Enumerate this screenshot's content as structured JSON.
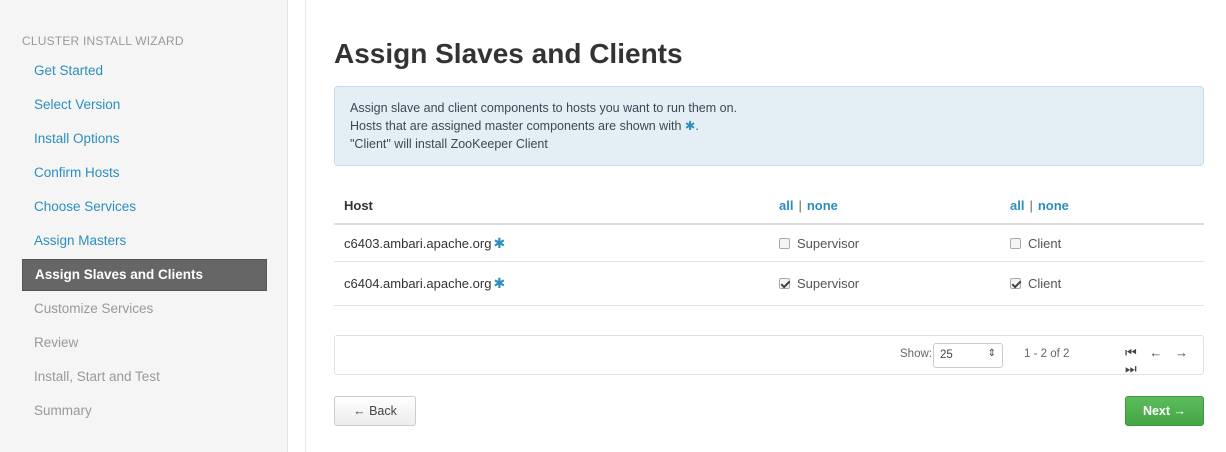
{
  "sidebar": {
    "header": "CLUSTER INSTALL WIZARD",
    "items": [
      {
        "label": "Get Started",
        "state": "link"
      },
      {
        "label": "Select Version",
        "state": "link"
      },
      {
        "label": "Install Options",
        "state": "link"
      },
      {
        "label": "Confirm Hosts",
        "state": "link"
      },
      {
        "label": "Choose Services",
        "state": "link"
      },
      {
        "label": "Assign Masters",
        "state": "link"
      },
      {
        "label": "Assign Slaves and Clients",
        "state": "active"
      },
      {
        "label": "Customize Services",
        "state": "disabled"
      },
      {
        "label": "Review",
        "state": "disabled"
      },
      {
        "label": "Install, Start and Test",
        "state": "disabled"
      },
      {
        "label": "Summary",
        "state": "disabled"
      }
    ]
  },
  "main": {
    "title": "Assign Slaves and Clients",
    "alert": {
      "line1": "Assign slave and client components to hosts you want to run them on.",
      "line2": "Hosts that are assigned master components are shown with",
      "line2_marker": "✱",
      "line2_end": ".",
      "line3": "\"Client\" will install ZooKeeper Client"
    },
    "table": {
      "host_header": "Host",
      "all_label": "all",
      "separator": "|",
      "none_label": "none",
      "host_marker": "✱",
      "rows": [
        {
          "host": "c6403.ambari.apache.org",
          "supervisor": "Supervisor",
          "supervisor_checked": false,
          "client": "Client",
          "client_checked": false
        },
        {
          "host": "c6404.ambari.apache.org",
          "supervisor": "Supervisor",
          "supervisor_checked": true,
          "client": "Client",
          "client_checked": true
        }
      ]
    },
    "pager": {
      "show_label": "Show:",
      "page_size": "25",
      "range": "1 - 2 of 2",
      "first_icon": "Ⲙ",
      "prev_icon": "←",
      "next_icon": "→",
      "last_icon": "Ⲙ"
    },
    "back_label": "← Back",
    "next_label": "Next →"
  },
  "colors": {
    "link": "#2a8fbd",
    "active_nav_bg": "#666666",
    "alert_bg": "#e3eef5",
    "next_button": "#4cae4c"
  }
}
